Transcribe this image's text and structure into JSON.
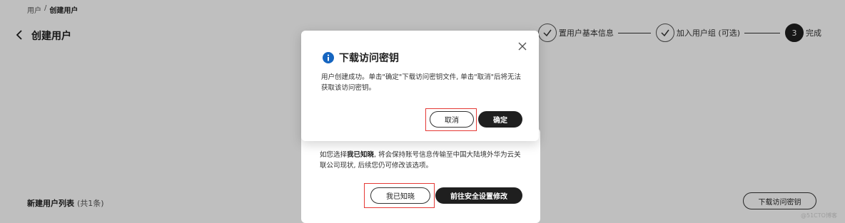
{
  "breadcrumb": {
    "parent": "用户",
    "separator": "/",
    "current": "创建用户"
  },
  "header": {
    "title": "创建用户"
  },
  "steps": [
    {
      "number": "",
      "label": "置用户基本信息",
      "state": "done"
    },
    {
      "number": "",
      "label": "加入用户组 (可选)",
      "state": "done"
    },
    {
      "number": "3",
      "label": "完成",
      "state": "active"
    }
  ],
  "user_list": {
    "title": "新建用户列表",
    "count": "(共1条)",
    "download_label": "下载访问密钥"
  },
  "security_dialog": {
    "text_prefix": "如您选择",
    "text_bold": "我已知晓",
    "text_rest": ", 将会保持账号信息传输至中国大陆境外华为云关联公司现状, 后续您仍可修改该选项。",
    "ack_label": "我已知晓",
    "go_settings_label": "前往安全设置修改"
  },
  "download_dialog": {
    "title": "下载访问密钥",
    "body": "用户创建成功。单击\"确定\"下载访问密钥文件, 单击\"取消\"后将无法获取该访问密钥。",
    "cancel_label": "取消",
    "confirm_label": "确定"
  },
  "colors": {
    "highlight": "#e53935",
    "primary": "#1f1f1f",
    "info": "#1565c0"
  },
  "watermark": "@51CTO博客"
}
